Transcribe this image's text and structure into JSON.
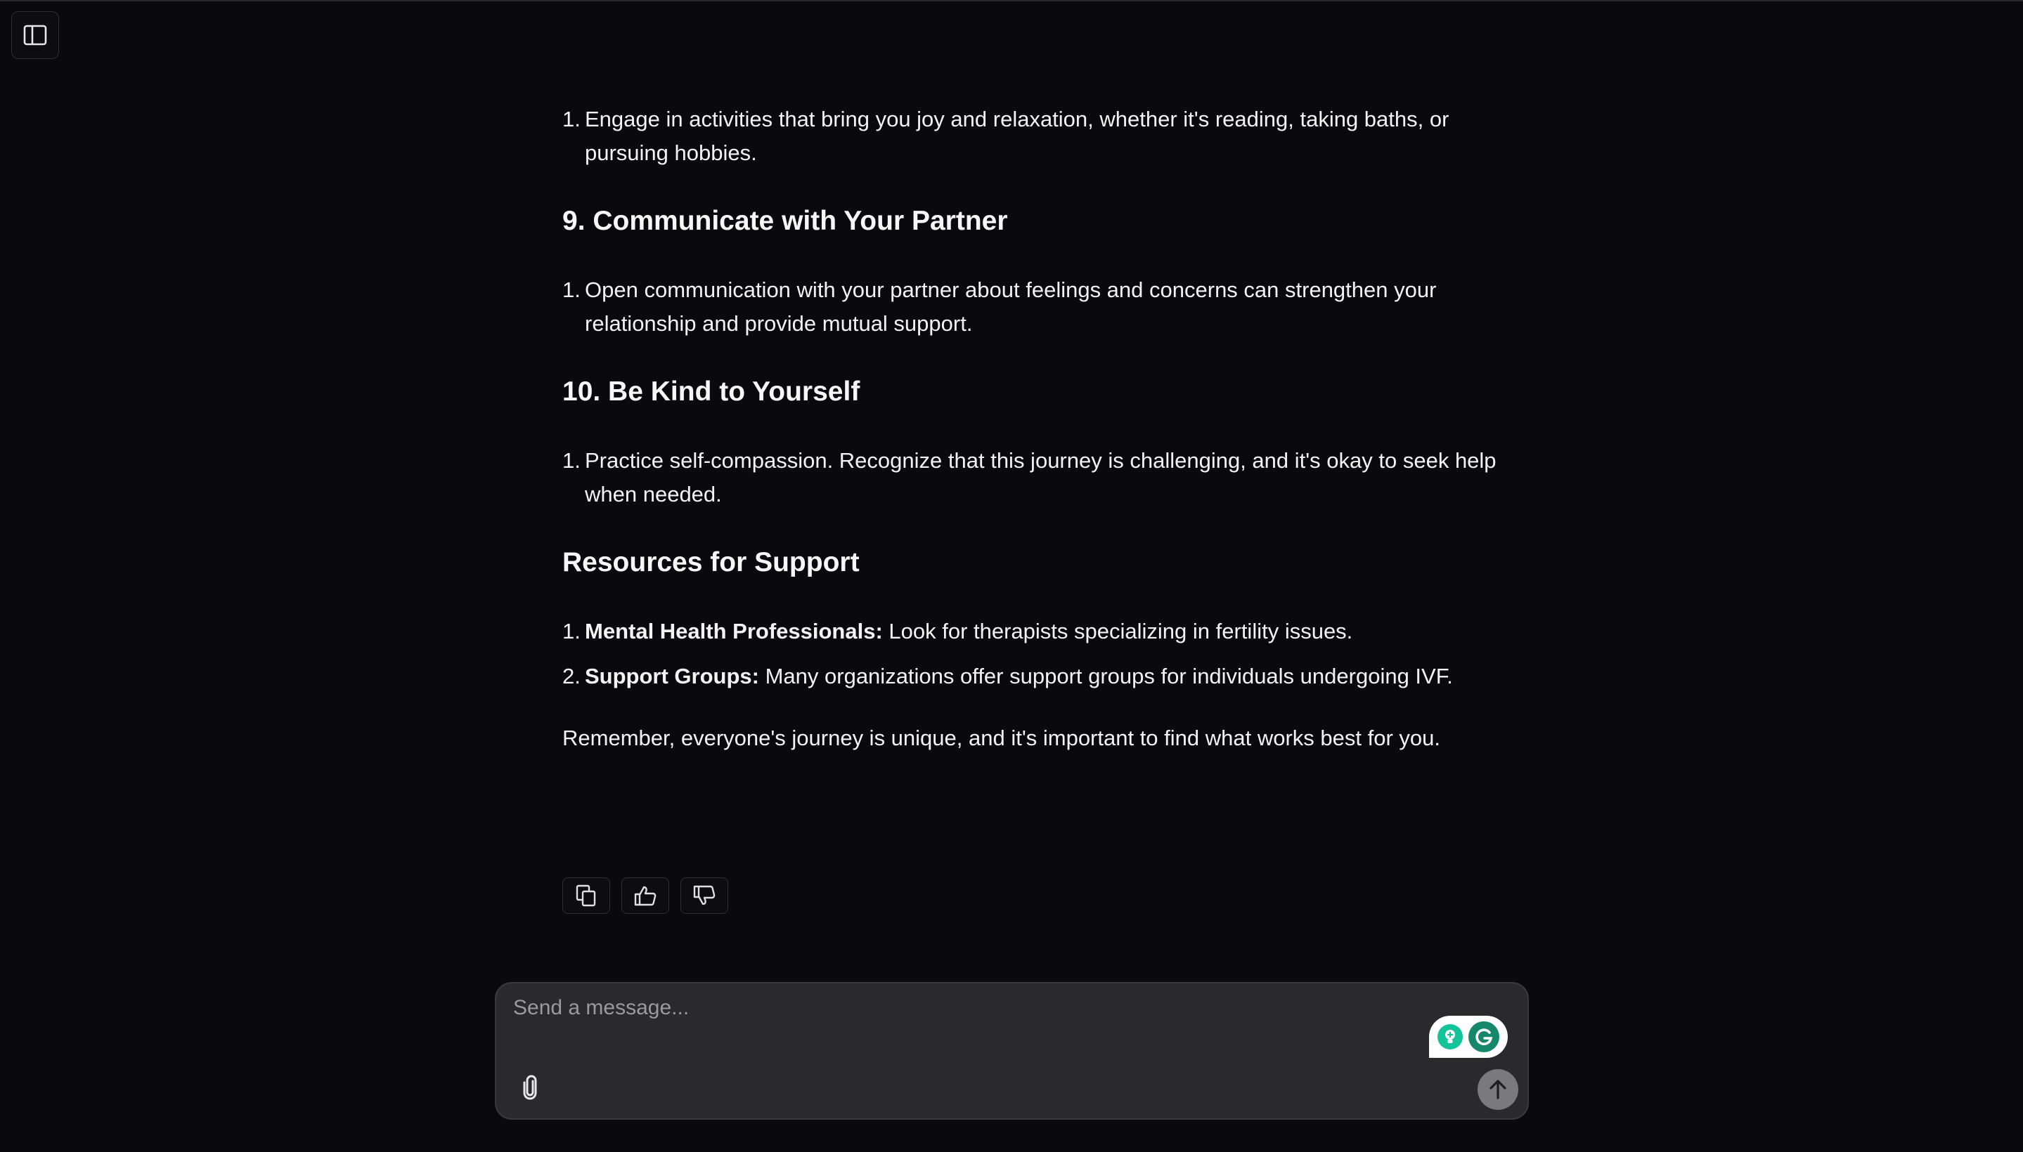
{
  "app": {
    "sidebar_toggle_icon": "sidebar-panel-icon"
  },
  "message": {
    "blocks": [
      {
        "type": "list",
        "items": [
          {
            "num": "1.",
            "bold": "",
            "text": "Engage in activities that bring you joy and relaxation, whether it's reading, taking baths, or pursuing hobbies."
          }
        ]
      },
      {
        "type": "heading",
        "text": "9. Communicate with Your Partner"
      },
      {
        "type": "list",
        "items": [
          {
            "num": "1.",
            "bold": "",
            "text": "Open communication with your partner about feelings and concerns can strengthen your relationship and provide mutual support."
          }
        ]
      },
      {
        "type": "heading",
        "text": "10. Be Kind to Yourself"
      },
      {
        "type": "list",
        "items": [
          {
            "num": "1.",
            "bold": "",
            "text": "Practice self-compassion. Recognize that this journey is challenging, and it's okay to seek help when needed."
          }
        ]
      },
      {
        "type": "heading",
        "text": "Resources for Support"
      },
      {
        "type": "list",
        "items": [
          {
            "num": "1.",
            "bold": "Mental Health Professionals:",
            "text": " Look for therapists specializing in fertility issues."
          },
          {
            "num": "2.",
            "bold": "Support Groups:",
            "text": " Many organizations offer support groups for individuals undergoing IVF."
          }
        ]
      },
      {
        "type": "paragraph",
        "text": "Remember, everyone's journey is unique, and it's important to find what works best for you."
      }
    ],
    "actions": [
      {
        "name": "copy-button",
        "icon": "copy-icon"
      },
      {
        "name": "thumbs-up-button",
        "icon": "thumbs-up-icon"
      },
      {
        "name": "thumbs-down-button",
        "icon": "thumbs-down-icon"
      }
    ]
  },
  "composer": {
    "placeholder": "Send a message...",
    "value": "",
    "attach_icon": "paperclip-icon",
    "send_icon": "arrow-up-icon"
  },
  "colors": {
    "background": "#0a0a0c",
    "composer_bg": "#2a2a2c",
    "send_button": "#7a7a7e",
    "grammarly_green": "#15c39a"
  }
}
